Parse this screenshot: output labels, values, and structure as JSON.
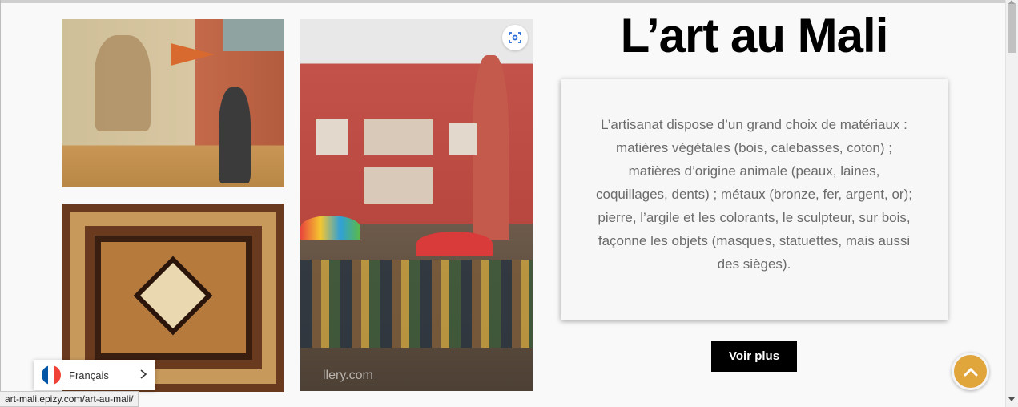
{
  "page": {
    "title": "L’art au Mali",
    "description": "L’artisanat dispose d’un grand choix de matériaux : matières végétales (bois, calebasses, coton) ; matières d’origine animale (peaux, laines, coquillages, dents) ; métaux (bronze, fer, argent, or); pierre, l’argile et les colorants, le sculpteur, sur bois, façonne les objets (masques, statuettes, mais aussi des sièges).",
    "more_button": "Voir plus"
  },
  "images": {
    "mural_icon": "photo-mural",
    "tapestry_icon": "photo-tapestry",
    "market_icon": "photo-market",
    "market_watermark": "llery.com",
    "scan_icon": "visual-search-icon"
  },
  "language_switcher": {
    "label": "Français",
    "flag_colors": [
      "#0055a4",
      "#ffffff",
      "#ef4135"
    ]
  },
  "status_bar": {
    "url": "art-mali.epizy.com/art-au-mali/"
  },
  "colors": {
    "scroll_top_button": "#e0a63c",
    "button_bg": "#000000"
  }
}
